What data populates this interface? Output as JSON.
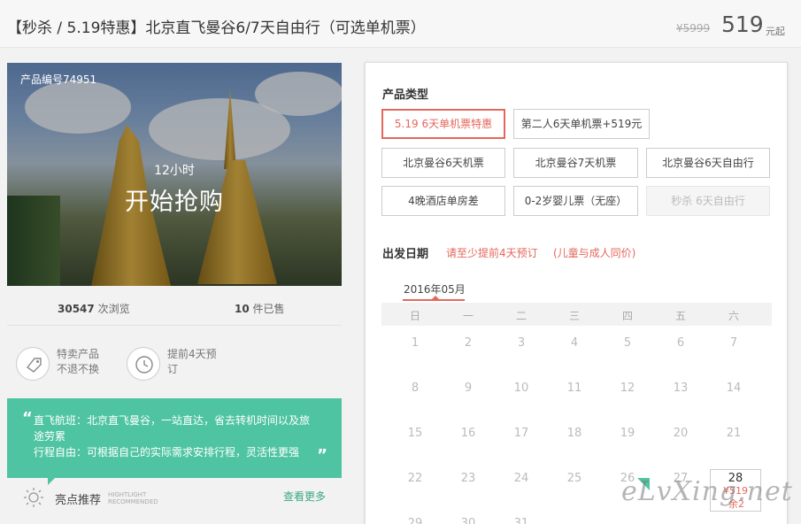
{
  "header": {
    "title": "【秒杀 / 5.19特惠】北京直飞曼谷6/7天自由行（可选单机票）",
    "price_old": "¥5999",
    "price_new": "519",
    "price_unit": "元起"
  },
  "hero": {
    "product_code": "产品编号74951",
    "countdown_label": "12小时",
    "countdown_main": "开始抢购"
  },
  "stats": {
    "views_count": "30547",
    "views_label": "次浏览",
    "sold_count": "10",
    "sold_label": "件已售"
  },
  "features": [
    {
      "icon": "tag-icon",
      "line1": "特卖产品",
      "line2": "不退不换"
    },
    {
      "icon": "clock-icon",
      "line1": "提前4天预",
      "line2": "订"
    }
  ],
  "highlight_box": {
    "line1": "直飞航班：北京直飞曼谷，一站直达，省去转机时间以及旅",
    "line2": "途劳累",
    "line3": "行程自由：可根据自己的实际需求安排行程，灵活性更强"
  },
  "highlight_bar": {
    "label": "亮点推荐",
    "en_line1": "HIGHTLIGHT",
    "en_line2": "RECOMMENDED",
    "more": "查看更多"
  },
  "product_type": {
    "label": "产品类型",
    "options": [
      {
        "label": "5.19 6天单机票特惠",
        "state": "selected"
      },
      {
        "label": "第二人6天单机票+519元",
        "state": "normal"
      },
      {
        "label": "北京曼谷6天机票",
        "state": "normal"
      },
      {
        "label": "北京曼谷7天机票",
        "state": "normal"
      },
      {
        "label": "北京曼谷6天自由行",
        "state": "normal"
      },
      {
        "label": "4晚酒店单房差",
        "state": "normal"
      },
      {
        "label": "0-2岁婴儿票（无座）",
        "state": "normal"
      },
      {
        "label": "秒杀 6天自由行",
        "state": "disabled"
      }
    ]
  },
  "departure": {
    "label": "出发日期",
    "notice1": "请至少提前4天预订",
    "notice2": "(儿童与成人同价)",
    "month": "2016年05月",
    "weekdays": [
      "日",
      "一",
      "二",
      "三",
      "四",
      "五",
      "六"
    ],
    "days": [
      "1",
      "2",
      "3",
      "4",
      "5",
      "6",
      "7",
      "8",
      "9",
      "10",
      "11",
      "12",
      "13",
      "14",
      "15",
      "16",
      "17",
      "18",
      "19",
      "20",
      "21",
      "22",
      "23",
      "24",
      "25",
      "26",
      "27",
      "28",
      "29",
      "30",
      "31"
    ],
    "active_day": {
      "day": "28",
      "price": "¥519",
      "left": "余2"
    }
  },
  "watermark": "eLvXing.net",
  "colors": {
    "accent": "#e4675c",
    "green": "#4fc4a2"
  }
}
